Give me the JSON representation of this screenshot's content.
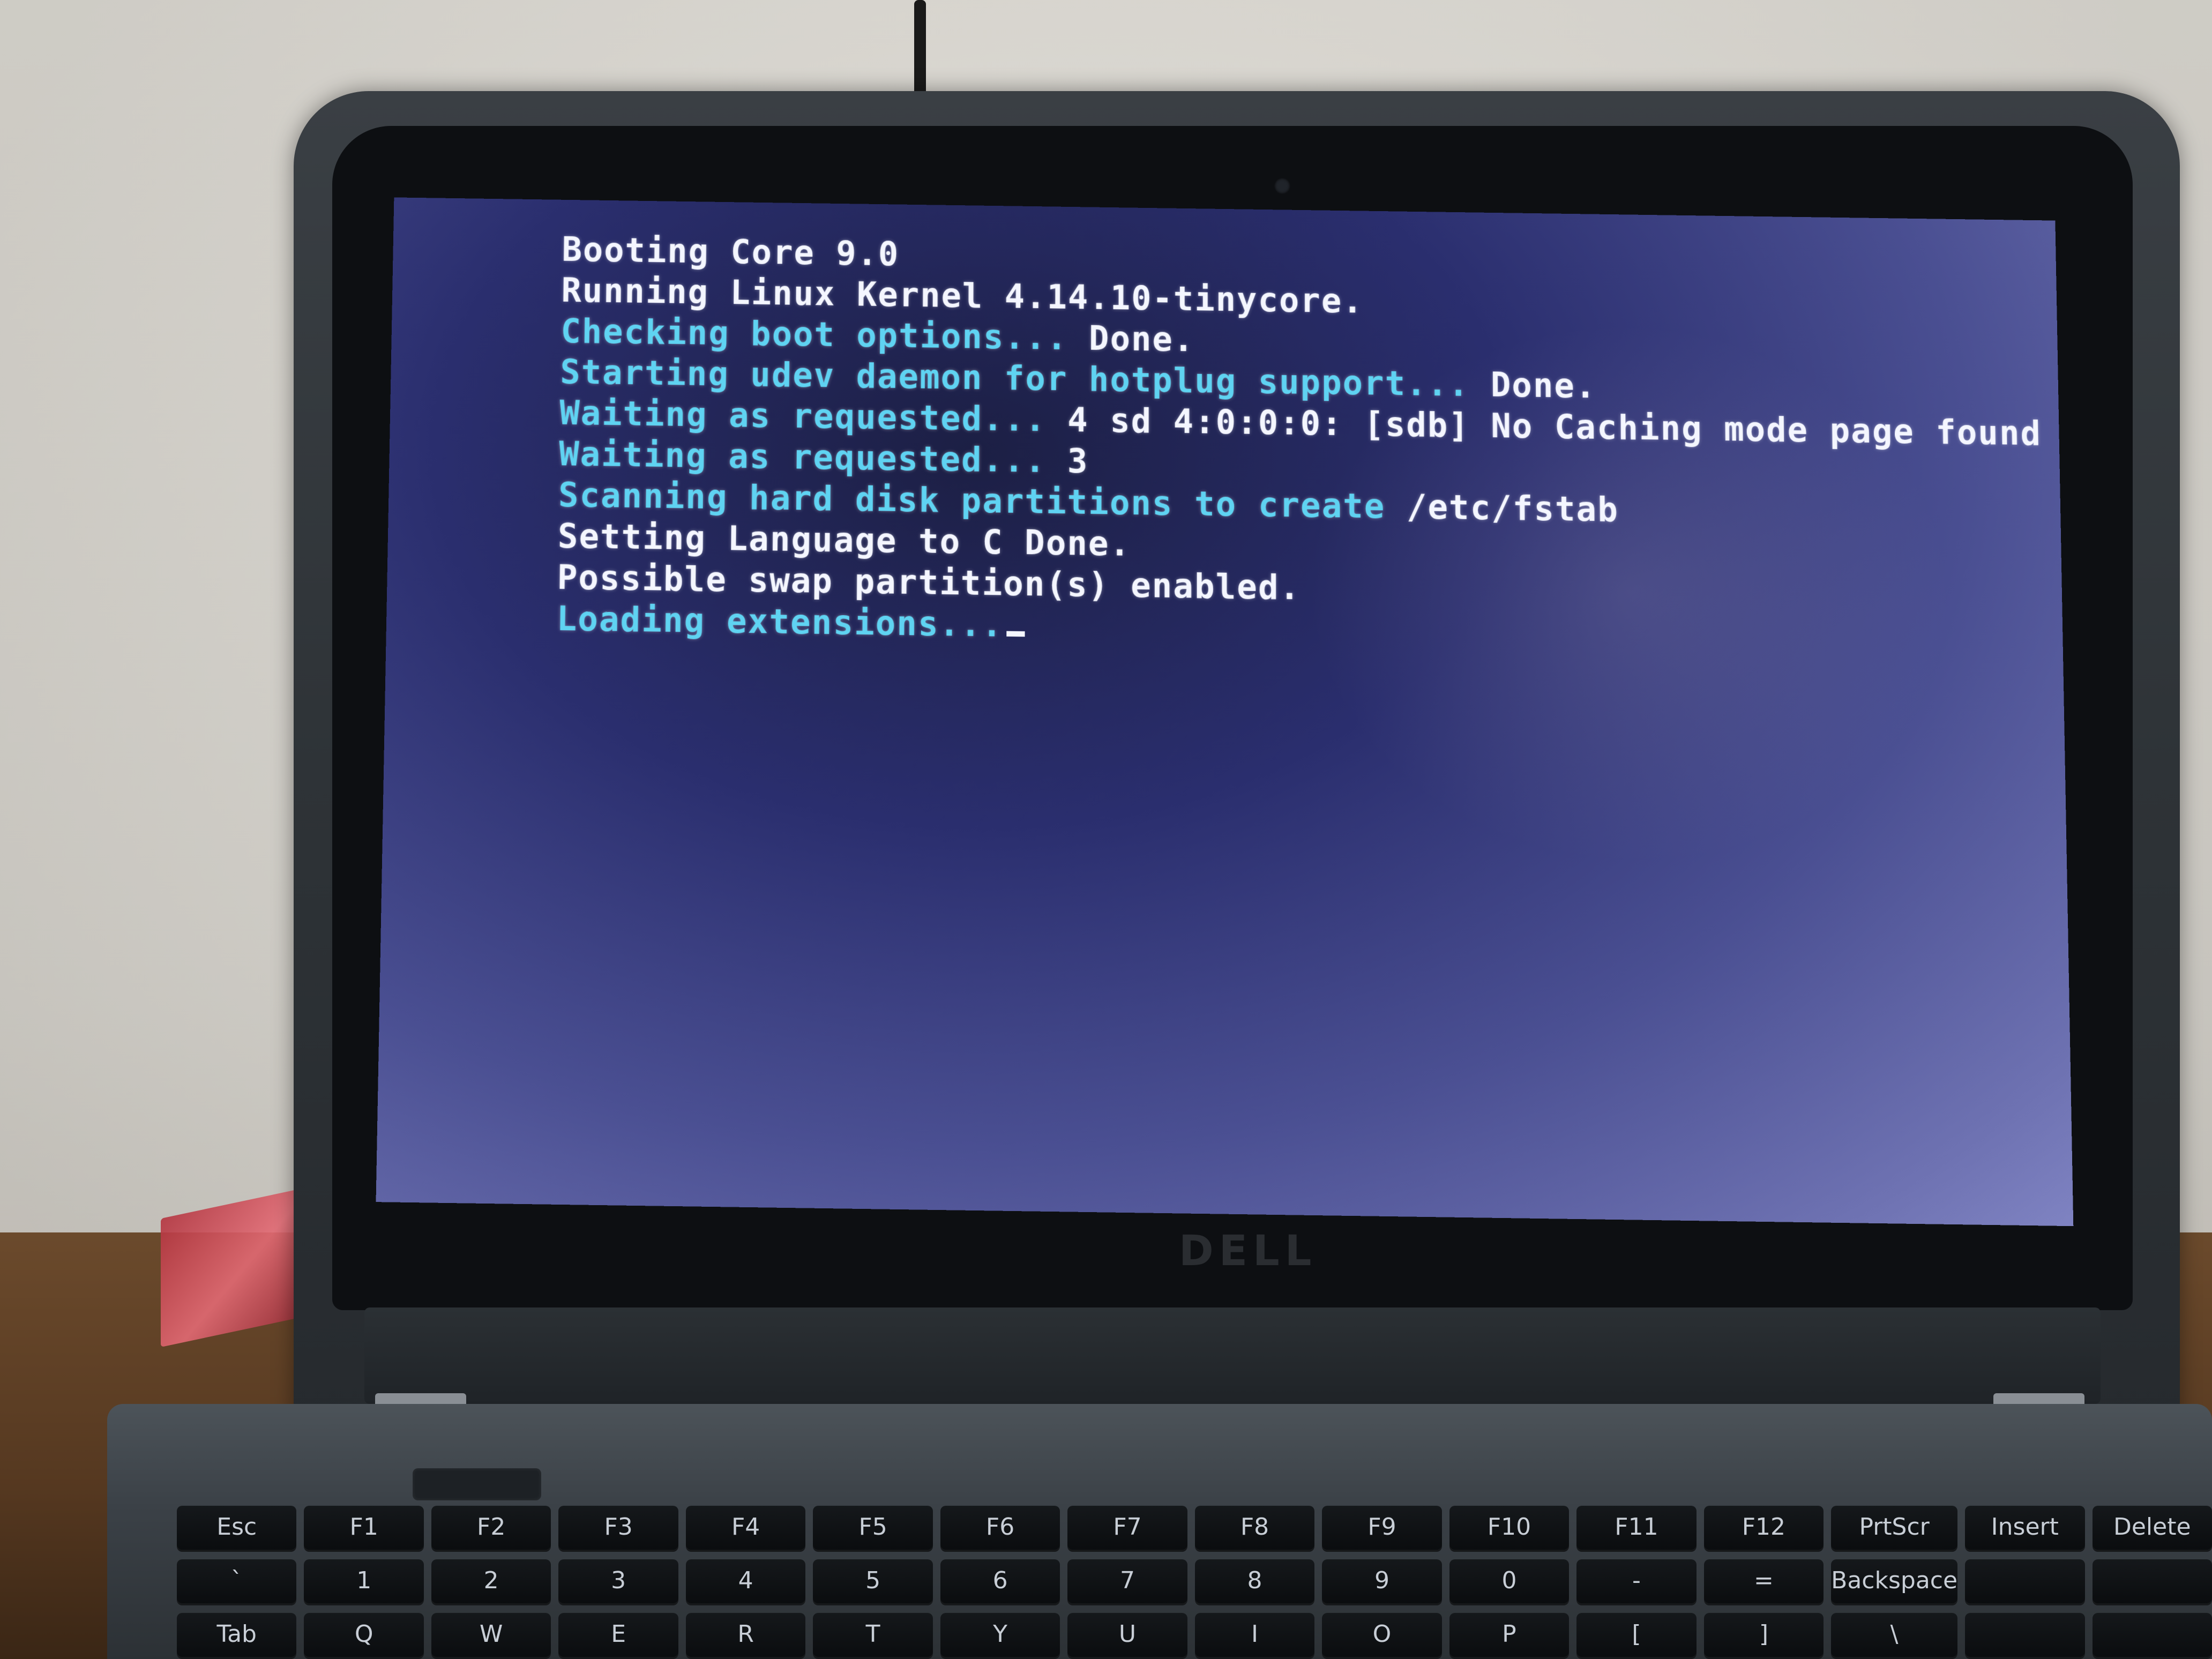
{
  "terminal": {
    "lines": [
      {
        "text": "Booting Core 9.0",
        "color": "white"
      },
      {
        "text": "Running Linux Kernel 4.14.10-tinycore.",
        "color": "white"
      },
      {
        "text": "Checking boot options... Done.",
        "color": "cyan-white"
      },
      {
        "text": "Starting udev daemon for hotplug support... Done.",
        "color": "cyan-white"
      },
      {
        "text": "Waiting as requested... 4 sd 4:0:0:0: [sdb] No Caching mode page found",
        "color": "cyan-white"
      },
      {
        "text": "Waiting as requested... 3",
        "color": "cyan-white"
      },
      {
        "text": "Scanning hard disk partitions to create /etc/fstab",
        "color": "cyan-white"
      },
      {
        "text": "Setting Language to C Done.",
        "color": "white"
      },
      {
        "text": "Possible swap partition(s) enabled.",
        "color": "white"
      },
      {
        "text": "Loading extensions...",
        "color": "cyan"
      }
    ],
    "segments": {
      "line3_prefix": "Checking boot options...",
      "line3_suffix": " Done.",
      "line4_prefix": "Starting udev daemon for hotplug support...",
      "line4_suffix": " Done.",
      "line5_prefix": "Waiting as requested...",
      "line5_suffix": " 4 sd 4:0:0:0: [sdb] No Caching mode page found",
      "line6_prefix": "Waiting as requested...",
      "line6_suffix": " 3",
      "line7_prefix": "Scanning hard disk partitions to create",
      "line7_suffix": " /etc/fstab"
    },
    "colors": {
      "white": "#f4f6ff",
      "cyan": "#5fd3f2",
      "screen_bg": "#2a2e6e"
    }
  },
  "laptop": {
    "logo": "DELL"
  },
  "keyboard": {
    "row1": [
      "Esc",
      "F1",
      "F2",
      "F3",
      "F4",
      "F5",
      "F6",
      "F7",
      "F8",
      "F9",
      "F10",
      "F11",
      "F12",
      "PrtScr",
      "Insert",
      "Delete"
    ],
    "row2": [
      "`",
      "1",
      "2",
      "3",
      "4",
      "5",
      "6",
      "7",
      "8",
      "9",
      "0",
      "-",
      "=",
      "Backspace",
      "",
      ""
    ],
    "row3": [
      "Tab",
      "Q",
      "W",
      "E",
      "R",
      "T",
      "Y",
      "U",
      "I",
      "O",
      "P",
      "[",
      "]",
      "\\",
      "",
      ""
    ]
  }
}
